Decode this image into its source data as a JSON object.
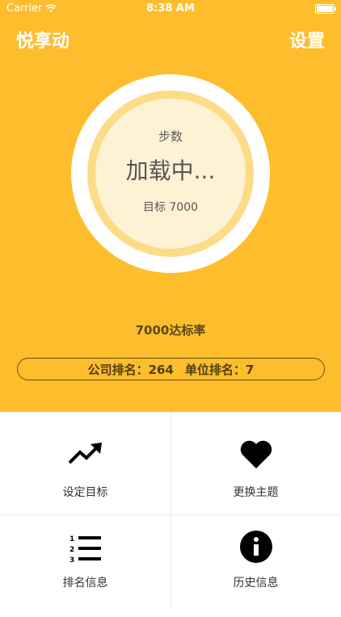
{
  "status_bar": {
    "carrier": "Carrier",
    "time": "8:38 AM"
  },
  "nav": {
    "title": "悦享动",
    "settings": "设置"
  },
  "steps": {
    "label": "步数",
    "value": "加载中...",
    "goal": "目标 7000"
  },
  "rate_label": "7000达标率",
  "ranking": {
    "company": "公司排名：264",
    "unit": "单位排名：7"
  },
  "menu": {
    "set_goal": "设定目标",
    "change_theme": "更换主题",
    "rank_info": "排名信息",
    "history_info": "历史信息"
  },
  "colors": {
    "theme": "#FDBD2C",
    "ring_mid": "#FCDC87",
    "ring_inner": "#FEF2D5"
  }
}
